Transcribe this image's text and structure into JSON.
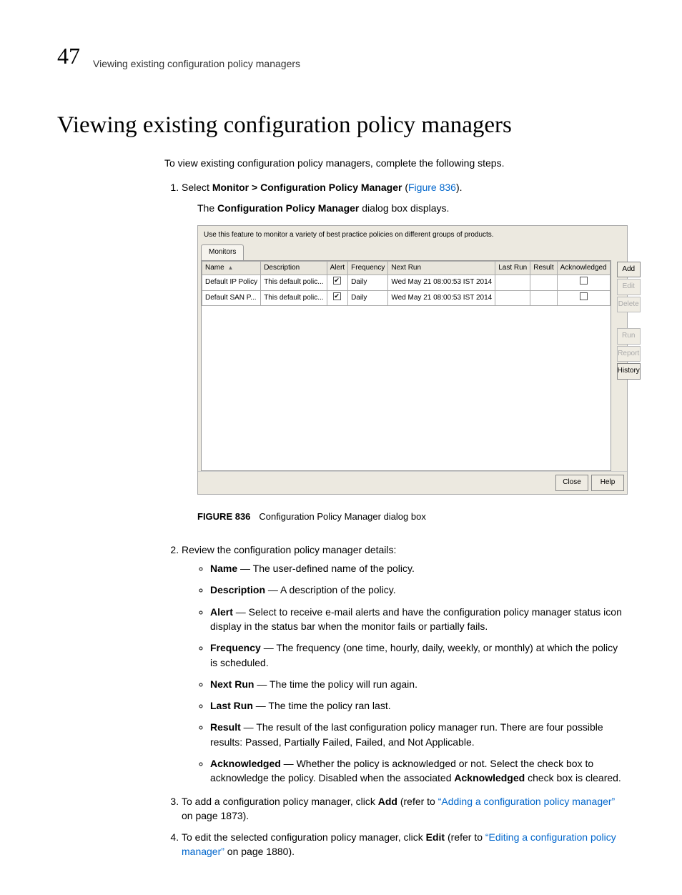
{
  "header": {
    "chapter_num": "47",
    "running_title": "Viewing existing configuration policy managers"
  },
  "title": "Viewing existing configuration policy managers",
  "intro": "To view existing configuration policy managers, complete the following steps.",
  "steps": {
    "one_prefix": "Select ",
    "one_menu": "Monitor > Configuration Policy Manager",
    "one_open_paren": " (",
    "one_figref": "Figure 836",
    "one_close_paren": ").",
    "one_sub_prefix": "The ",
    "one_sub_bold": "Configuration Policy Manager",
    "one_sub_suffix": " dialog box displays.",
    "two": "Review the configuration policy manager details:",
    "three_prefix": "To add a configuration policy manager, click ",
    "three_bold": "Add",
    "three_mid": " (refer to ",
    "three_link": "“Adding a configuration policy manager”",
    "three_suffix": " on page 1873).",
    "four_prefix": "To edit the selected configuration policy manager, click ",
    "four_bold": "Edit",
    "four_mid": " (refer to ",
    "four_link": "“Editing a configuration policy manager”",
    "four_suffix": " on page 1880)."
  },
  "bullets": {
    "name": {
      "term": "Name",
      "desc": " — The user-defined name of the policy."
    },
    "description": {
      "term": "Description",
      "desc": " — A description of the policy."
    },
    "alert": {
      "term": "Alert",
      "desc": " — Select to receive e-mail alerts and have the configuration policy manager status icon display in the status bar when the monitor fails or partially fails."
    },
    "frequency": {
      "term": "Frequency",
      "desc": " — The frequency (one time, hourly, daily, weekly, or monthly) at which the policy is scheduled."
    },
    "nextrun": {
      "term": "Next Run",
      "desc": " — The time the policy will run again."
    },
    "lastrun": {
      "term": "Last Run",
      "desc": " — The time the policy ran last."
    },
    "result": {
      "term": "Result",
      "desc": " — The result of the last configuration policy manager run. There are four possible results: Passed, Partially Failed, Failed, and Not Applicable."
    },
    "ack": {
      "term": "Acknowledged",
      "desc_a": " — Whether the policy is acknowledged or not. Select the check box to acknowledge the policy. Disabled when the associated ",
      "desc_b": "Acknowledged",
      "desc_c": " check box is cleared."
    }
  },
  "figure": {
    "caption_label": "FIGURE 836",
    "caption_text": "Configuration Policy Manager dialog box",
    "hint": "Use this feature to monitor a variety of best practice policies on different groups of products.",
    "tab": "Monitors",
    "headers": [
      "Name ",
      "Description",
      "Alert",
      "Frequency",
      "Next Run",
      "Last Run",
      "Result",
      "Acknowledged"
    ],
    "rows": [
      {
        "name": "Default IP Policy",
        "desc": "This default polic...",
        "alert": true,
        "freq": "Daily",
        "next": "Wed May 21 08:00:53 IST 2014",
        "last": "",
        "result": "",
        "ack": false
      },
      {
        "name": "Default SAN P...",
        "desc": "This default polic...",
        "alert": true,
        "freq": "Daily",
        "next": "Wed May 21 08:00:53 IST 2014",
        "last": "",
        "result": "",
        "ack": false
      }
    ],
    "buttons": {
      "add": "Add",
      "edit": "Edit",
      "delete": "Delete",
      "run": "Run",
      "report": "Report",
      "history": "History",
      "close": "Close",
      "help": "Help"
    }
  }
}
